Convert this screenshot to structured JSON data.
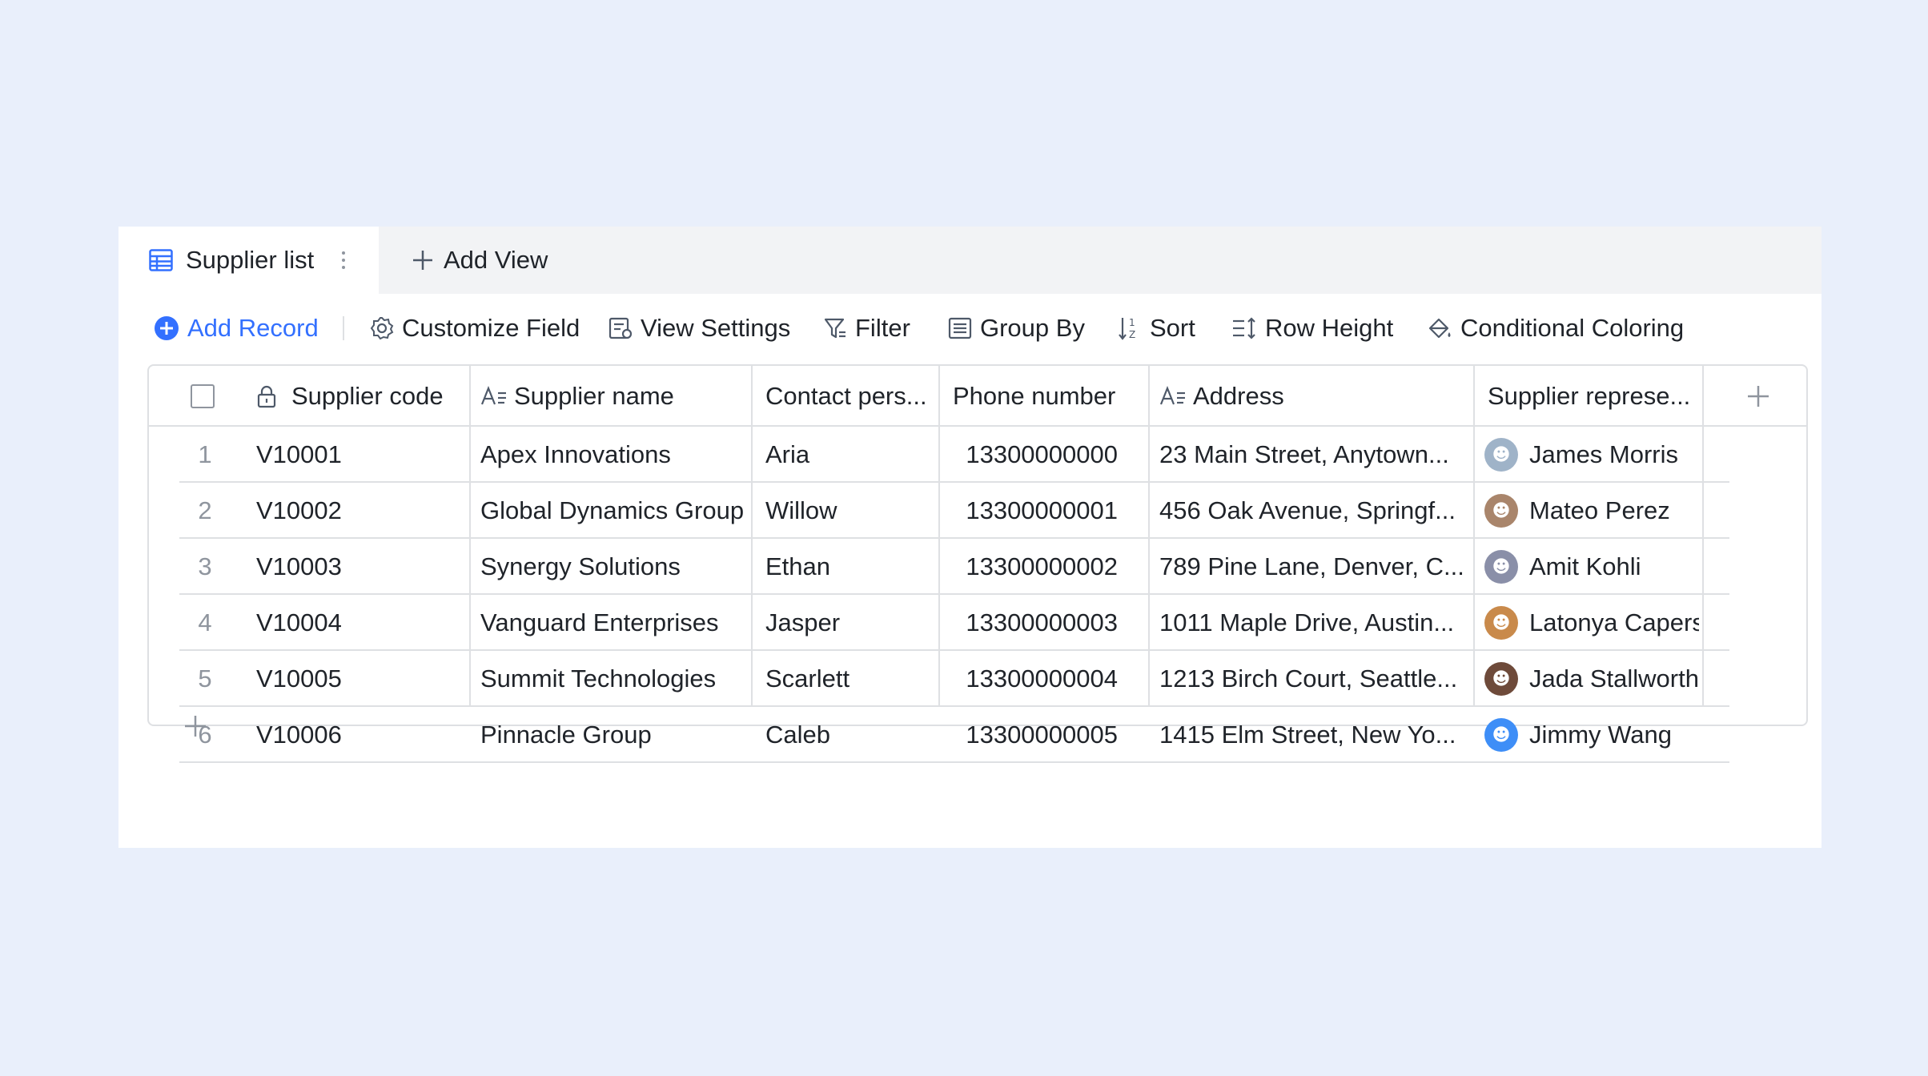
{
  "tabs": {
    "active_label": "Supplier list",
    "add_view_label": "Add View"
  },
  "toolbar": {
    "add_record": "Add Record",
    "customize_field": "Customize Field",
    "view_settings": "View Settings",
    "filter": "Filter",
    "group_by": "Group By",
    "sort": "Sort",
    "row_height": "Row Height",
    "conditional_coloring": "Conditional Coloring"
  },
  "columns": {
    "supplier_code": "Supplier code",
    "supplier_name": "Supplier name",
    "contact_person": "Contact pers...",
    "phone_number": "Phone number",
    "address": "Address",
    "supplier_rep": "Supplier represe..."
  },
  "rows": [
    {
      "num": "1",
      "code": "V10001",
      "name": "Apex Innovations",
      "contact": "Aria",
      "phone": "13300000000",
      "address": "23 Main Street, Anytown...",
      "rep": "James Morris",
      "avatar_color": "#9fb3c8"
    },
    {
      "num": "2",
      "code": "V10002",
      "name": "Global Dynamics Group",
      "contact": "Willow",
      "phone": "13300000001",
      "address": "456 Oak Avenue, Springf...",
      "rep": "Mateo Perez",
      "avatar_color": "#a9856b"
    },
    {
      "num": "3",
      "code": "V10003",
      "name": "Synergy Solutions",
      "contact": "Ethan",
      "phone": "13300000002",
      "address": "789 Pine Lane, Denver, C...",
      "rep": "Amit Kohli",
      "avatar_color": "#8a8fa8"
    },
    {
      "num": "4",
      "code": "V10004",
      "name": "Vanguard Enterprises",
      "contact": "Jasper",
      "phone": "13300000003",
      "address": "1011 Maple Drive, Austin...",
      "rep": "Latonya Capers",
      "avatar_color": "#c98a4b"
    },
    {
      "num": "5",
      "code": "V10005",
      "name": "Summit Technologies",
      "contact": "Scarlett",
      "phone": "13300000004",
      "address": "1213 Birch Court, Seattle...",
      "rep": "Jada Stallworth",
      "avatar_color": "#6e4a3a"
    },
    {
      "num": "6",
      "code": "V10006",
      "name": "Pinnacle Group",
      "contact": "Caleb",
      "phone": "13300000005",
      "address": "1415 Elm Street, New Yo...",
      "rep": "Jimmy Wang",
      "avatar_color": "#3e8ef7"
    }
  ]
}
